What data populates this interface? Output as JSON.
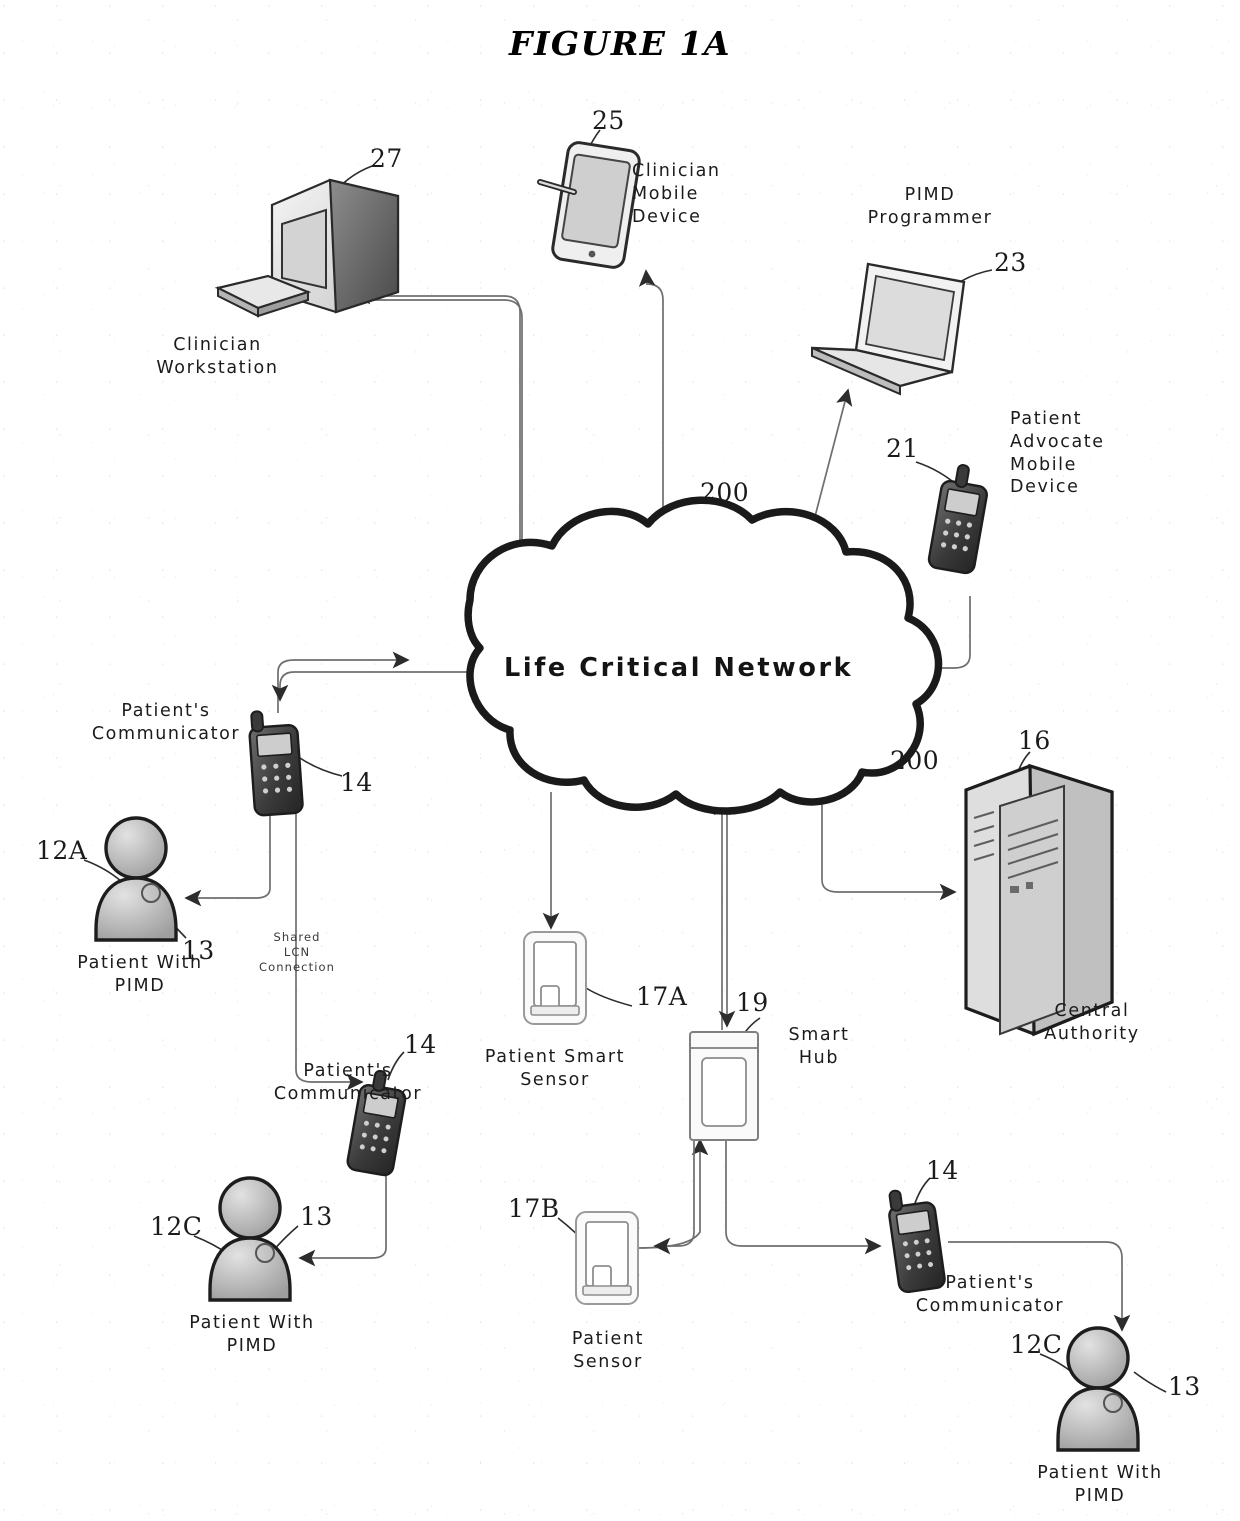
{
  "figure": {
    "title": "FIGURE 1A"
  },
  "network": {
    "label": "Life Critical Network",
    "ref_top": "200",
    "ref_bottom": "200"
  },
  "nodes": [
    {
      "id": "clinician-workstation",
      "label": "Clinician\nWorkstation",
      "ref": "27",
      "icon": "desktop-computer-icon"
    },
    {
      "id": "clinician-mobile-device",
      "label": "Clinician\nMobile\nDevice",
      "ref": "25",
      "icon": "tablet-stylus-icon"
    },
    {
      "id": "pimd-programmer",
      "label": "PIMD\nProgrammer",
      "ref": "23",
      "icon": "laptop-icon"
    },
    {
      "id": "patient-advocate-mobile-device",
      "label": "Patient\nAdvocate\nMobile\nDevice",
      "ref": "21",
      "icon": "cellphone-icon"
    },
    {
      "id": "central-authority",
      "label": "Central\nAuthority",
      "ref": "16",
      "icon": "server-tower-icon"
    },
    {
      "id": "patients-communicator-a",
      "label": "Patient's\nCommunicator",
      "ref": "14",
      "icon": "cellphone-icon"
    },
    {
      "id": "patient-with-pimd-a",
      "label": "Patient With\nPIMD",
      "ref": "12A",
      "implant_ref": "13",
      "icon": "person-icon"
    },
    {
      "id": "patients-communicator-c",
      "label": "Patient's\nCommunicator",
      "ref": "14",
      "icon": "cellphone-icon"
    },
    {
      "id": "patient-with-pimd-c",
      "label": "Patient With\nPIMD",
      "ref": "12C",
      "implant_ref": "13",
      "icon": "person-icon"
    },
    {
      "id": "patient-smart-sensor",
      "label": "Patient Smart\nSensor",
      "ref": "17A",
      "icon": "sensor-icon"
    },
    {
      "id": "smart-hub",
      "label": "Smart\nHub",
      "ref": "19",
      "icon": "hub-icon"
    },
    {
      "id": "patient-sensor",
      "label": "Patient\nSensor",
      "ref": "17B",
      "icon": "sensor-icon"
    },
    {
      "id": "patients-communicator-d",
      "label": "Patient's\nCommunicator",
      "ref": "14",
      "icon": "cellphone-icon"
    },
    {
      "id": "patient-with-pimd-d",
      "label": "Patient With\nPIMD",
      "ref": "12C",
      "implant_ref": "13",
      "icon": "person-icon"
    }
  ],
  "annotations": {
    "shared_lcn": "Shared\nLCN\nConnection"
  },
  "colors": {
    "ink": "#1b1b1b",
    "wire": "#6e6e6e",
    "cloud_outline": "#1a1a1a",
    "paper": "#ffffff"
  }
}
